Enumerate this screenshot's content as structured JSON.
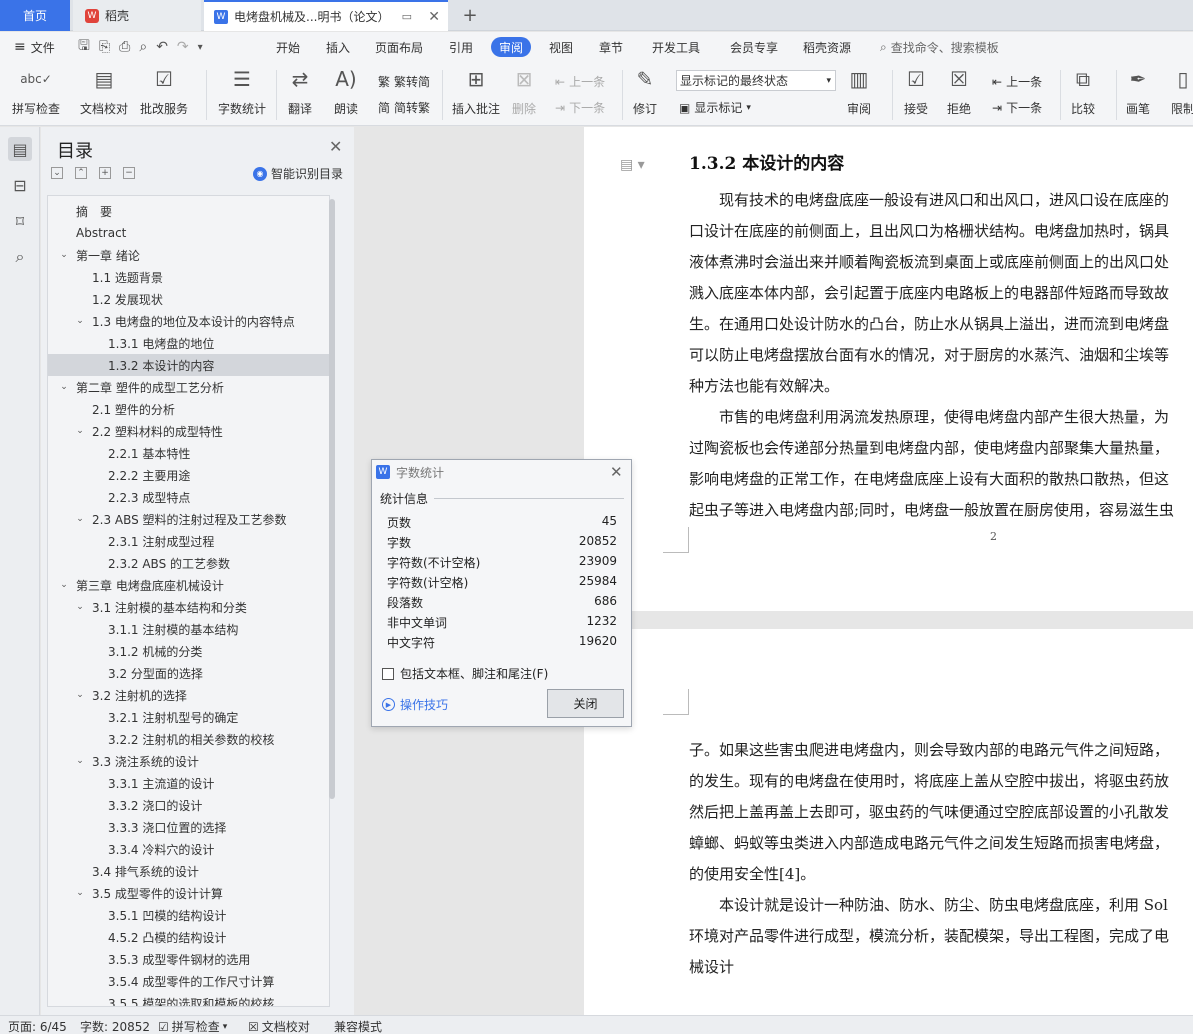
{
  "tabs": {
    "home": "首页",
    "wps": "稻壳",
    "doc": "电烤盘机械及...明书（论文）"
  },
  "menu": {
    "file": "文件",
    "items": [
      "开始",
      "插入",
      "页面布局",
      "引用",
      "审阅",
      "视图",
      "章节",
      "开发工具",
      "会员专享",
      "稻壳资源"
    ],
    "active": "审阅",
    "search": "查找命令、搜索模板"
  },
  "ribbon": {
    "spell": "拼写检查",
    "proof": "文档校对",
    "annotate_service": "批改服务",
    "wordcount": "字数统计",
    "translate": "翻译",
    "read": "朗读",
    "trad": "繁转简",
    "simp": "简转繁",
    "insert_comment": "插入批注",
    "delete": "删除",
    "prev_comment": "上一条",
    "next_comment": "下一条",
    "revise": "修订",
    "track_mode": "显示标记的最终状态",
    "show_marks": "显示标记",
    "review": "审阅",
    "accept": "接受",
    "reject": "拒绝",
    "prev_change": "上一条",
    "next_change": "下一条",
    "compare": "比较",
    "pen": "画笔",
    "restrict": "限制"
  },
  "outline": {
    "title": "目录",
    "smart": "智能识别目录",
    "items": [
      {
        "label": "摘　要",
        "level": 0
      },
      {
        "label": "Abstract",
        "level": 0
      },
      {
        "label": "第一章  绪论",
        "level": 0,
        "exp": true
      },
      {
        "label": "1.1  选题背景",
        "level": 1
      },
      {
        "label": "1.2  发展现状",
        "level": 1
      },
      {
        "label": "1.3 电烤盘的地位及本设计的内容特点",
        "level": 1,
        "exp": true
      },
      {
        "label": "1.3.1 电烤盘的地位",
        "level": 2
      },
      {
        "label": "1.3.2  本设计的内容",
        "level": 2,
        "sel": true
      },
      {
        "label": "第二章  塑件的成型工艺分析",
        "level": 0,
        "exp": true
      },
      {
        "label": "2.1 塑件的分析",
        "level": 1
      },
      {
        "label": "2.2  塑料材料的成型特性",
        "level": 1,
        "exp": true
      },
      {
        "label": "2.2.1  基本特性",
        "level": 2
      },
      {
        "label": "2.2.2  主要用途",
        "level": 2
      },
      {
        "label": "2.2.3  成型特点",
        "level": 2
      },
      {
        "label": "2.3 ABS 塑料的注射过程及工艺参数",
        "level": 1,
        "exp": true
      },
      {
        "label": "2.3.1  注射成型过程",
        "level": 2
      },
      {
        "label": "2.3.2 ABS 的工艺参数",
        "level": 2
      },
      {
        "label": "第三章  电烤盘底座机械设计",
        "level": 0,
        "exp": true
      },
      {
        "label": "3.1 注射模的基本结构和分类",
        "level": 1,
        "exp": true
      },
      {
        "label": "3.1.1 注射模的基本结构",
        "level": 2
      },
      {
        "label": "3.1.2 机械的分类",
        "level": 2
      },
      {
        "label": "3.2 分型面的选择",
        "level": 2
      },
      {
        "label": "3.2 注射机的选择",
        "level": 1,
        "exp": true
      },
      {
        "label": "3.2.1 注射机型号的确定",
        "level": 2
      },
      {
        "label": "3.2.2 注射机的相关参数的校核",
        "level": 2
      },
      {
        "label": "3.3 浇注系统的设计",
        "level": 1,
        "exp": true
      },
      {
        "label": "3.3.1  主流道的设计",
        "level": 2
      },
      {
        "label": "3.3.2  浇口的设计",
        "level": 2
      },
      {
        "label": "3.3.3  浇口位置的选择",
        "level": 2
      },
      {
        "label": "3.3.4  冷料穴的设计",
        "level": 2
      },
      {
        "label": "3.4  排气系统的设计",
        "level": 1
      },
      {
        "label": "3.5  成型零件的设计计算",
        "level": 1,
        "exp": true
      },
      {
        "label": "3.5.1 凹模的结构设计",
        "level": 2
      },
      {
        "label": "4.5.2  凸模的结构设计",
        "level": 2
      },
      {
        "label": "3.5.3  成型零件钢材的选用",
        "level": 2
      },
      {
        "label": "3.5.4  成型零件的工作尺寸计算",
        "level": 2
      },
      {
        "label": "3.5.5  模架的选取和模板的校核",
        "level": 2
      }
    ]
  },
  "document": {
    "heading": "1.3.2  本设计的内容",
    "page1_lines": [
      "　　现有技术的电烤盘底座一般设有进风口和出风口，进风口设在底座的",
      "口设计在底座的前侧面上，且出风口为格栅状结构。电烤盘加热时，锅具",
      "液体煮沸时会溢出来并顺着陶瓷板流到桌面上或底座前侧面上的出风口处",
      "溅入底座本体内部，会引起置于底座内电路板上的电器部件短路而导致故",
      "生。在通用口处设计防水的凸台，防止水从锅具上溢出，进而流到电烤盘",
      "可以防止电烤盘摆放台面有水的情况，对于厨房的水蒸汽、油烟和尘埃等",
      "种方法也能有效解决。",
      "　　市售的电烤盘利用涡流发热原理，使得电烤盘内部产生很大热量，为",
      "过陶瓷板也会传递部分热量到电烤盘内部，使电烤盘内部聚集大量热量，",
      "影响电烤盘的正常工作，在电烤盘底座上设有大面积的散热口散热，但这",
      "起虫子等进入电烤盘内部;同时，电烤盘一般放置在厨房使用，容易滋生虫"
    ],
    "page_number": "2",
    "page2_lines": [
      "子。如果这些害虫爬进电烤盘内，则会导致内部的电路元气件之间短路，",
      "的发生。现有的电烤盘在使用时，将底座上盖从空腔中拔出，将驱虫药放",
      "然后把上盖再盖上去即可，驱虫药的气味便通过空腔底部设置的小孔散发",
      "蟑螂、蚂蚁等虫类进入内部造成电路元气件之间发生短路而损害电烤盘，",
      "的使用安全性[4]。",
      "　　本设计就是设计一种防油、防水、防尘、防虫电烤盘底座，利用 Sol",
      "环境对产品零件进行成型，模流分析，装配模架，导出工程图，完成了电",
      "械设计"
    ]
  },
  "dialog": {
    "title": "字数统计",
    "group": "统计信息",
    "rows": [
      {
        "label": "页数",
        "value": "45"
      },
      {
        "label": "字数",
        "value": "20852"
      },
      {
        "label": "字符数(不计空格)",
        "value": "23909"
      },
      {
        "label": "字符数(计空格)",
        "value": "25984"
      },
      {
        "label": "段落数",
        "value": "686"
      },
      {
        "label": "非中文单词",
        "value": "1232"
      },
      {
        "label": "中文字符",
        "value": "19620"
      }
    ],
    "checkbox": "包括文本框、脚注和尾注(F)",
    "tips": "操作技巧",
    "close": "关闭"
  },
  "status": {
    "page": "页面: 6/45",
    "words": "字数: 20852",
    "spell": "拼写检查",
    "proof": "文档校对",
    "compat": "兼容模式"
  }
}
